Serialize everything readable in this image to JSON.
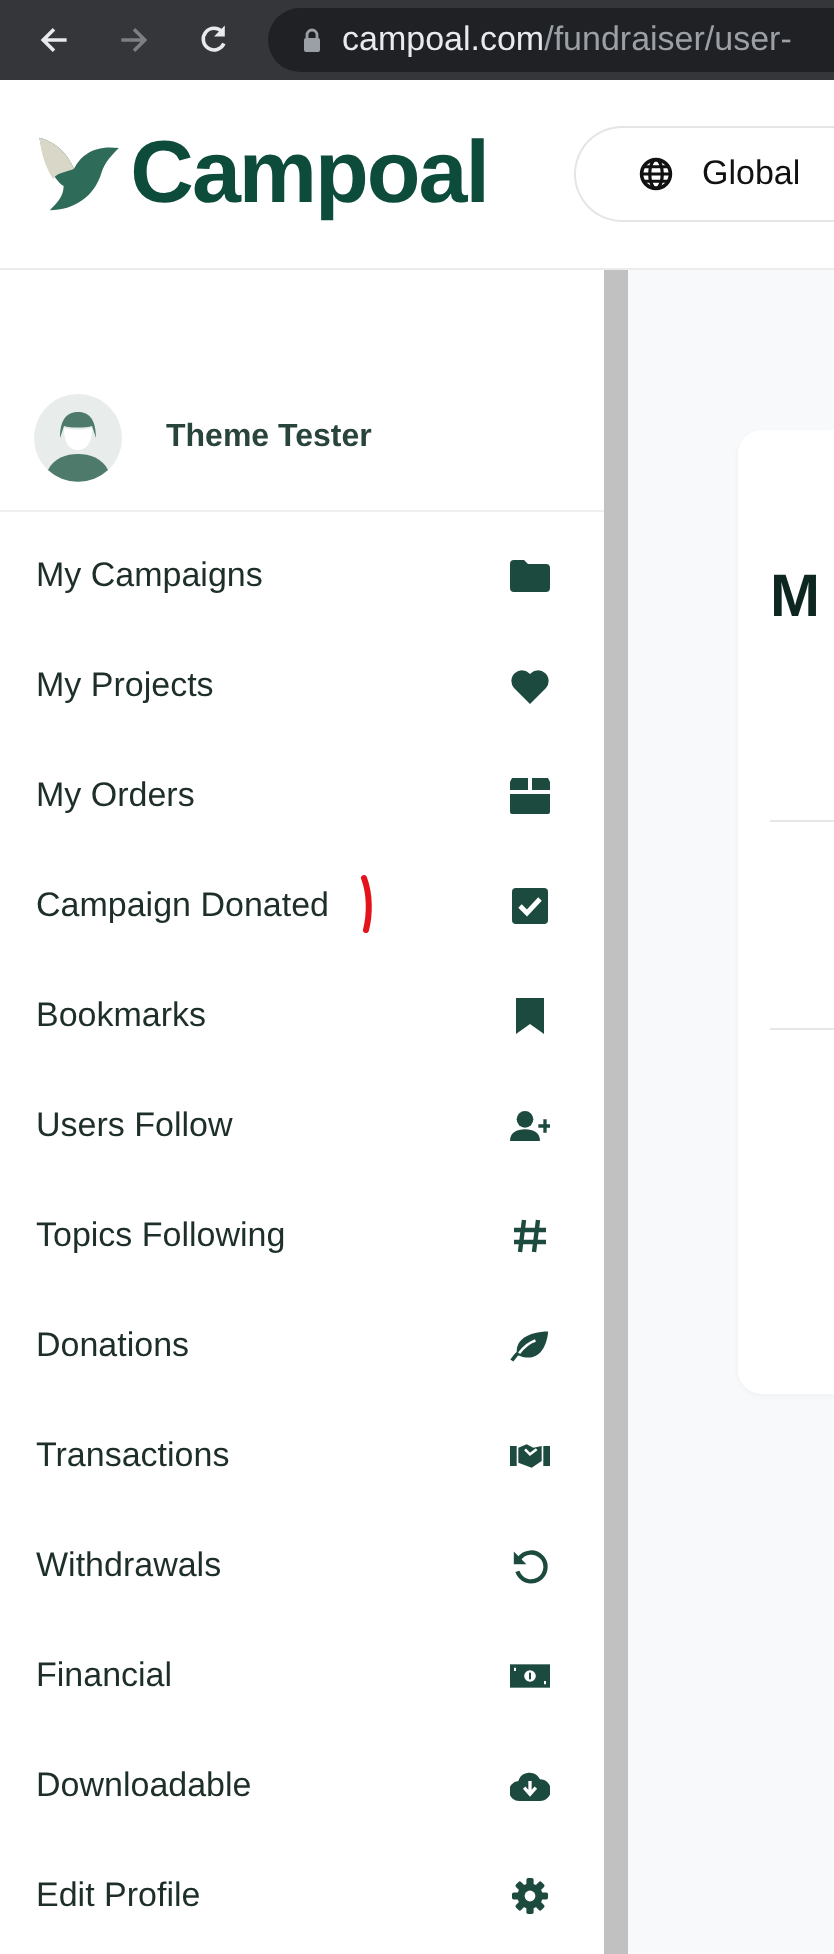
{
  "browser": {
    "url_host": "campoal.com",
    "url_path": "/fundraiser/user-"
  },
  "header": {
    "logo": "Campoal",
    "region_button": "Global"
  },
  "profile": {
    "name": "Theme Tester"
  },
  "menu": [
    {
      "label": "My Campaigns"
    },
    {
      "label": "My Projects"
    },
    {
      "label": "My Orders"
    },
    {
      "label": "Campaign Donated"
    },
    {
      "label": "Bookmarks"
    },
    {
      "label": "Users Follow"
    },
    {
      "label": "Topics Following"
    },
    {
      "label": "Donations"
    },
    {
      "label": "Transactions"
    },
    {
      "label": "Withdrawals"
    },
    {
      "label": "Financial"
    },
    {
      "label": "Downloadable"
    },
    {
      "label": "Edit Profile"
    }
  ],
  "content": {
    "heading": "M"
  }
}
